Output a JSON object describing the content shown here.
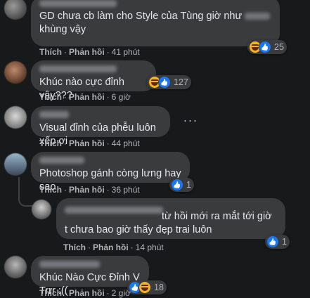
{
  "actions": {
    "like": "Thích",
    "reply": "Phản hồi",
    "sep": "·"
  },
  "more_icon": "more-horizontal-icon",
  "comments": [
    {
      "text": "GD chưa cb làm cho Style của Tùng giờ như",
      "text_after": "khùng vậy",
      "time": "41 phút",
      "reactions": [
        "haha",
        "like"
      ],
      "count": "25"
    },
    {
      "text": "Khúc nào cực đỉnh vậy???",
      "time": "6 giờ",
      "reactions": [
        "haha",
        "like"
      ],
      "count": "127"
    },
    {
      "text": "Visual đỉnh của phễu luôn xếp ơi",
      "time": "44 phút",
      "reactions": [],
      "count": ""
    },
    {
      "text": "Photoshop gánh còng lưng hay sao",
      "time": "36 phút",
      "reactions": [
        "like"
      ],
      "count": "1"
    },
    {
      "text": "từ hồi mới ra mắt tới giờ t chưa bao giờ thấy đẹp trai luôn",
      "time": "14 phút",
      "reactions": [
        "like"
      ],
      "count": "1"
    },
    {
      "text": "Khúc Nào Cực Đỉnh V Trrr :((",
      "time": "2 giờ",
      "reactions": [
        "like",
        "haha"
      ],
      "count": "18"
    }
  ],
  "colors": {
    "background": "#18191a",
    "bubble": "#3a3b3c",
    "text": "#e4e6eb",
    "secondary": "#b0b3b8",
    "like_blue": "#1877f2",
    "haha_yellow": "#f7b125"
  }
}
